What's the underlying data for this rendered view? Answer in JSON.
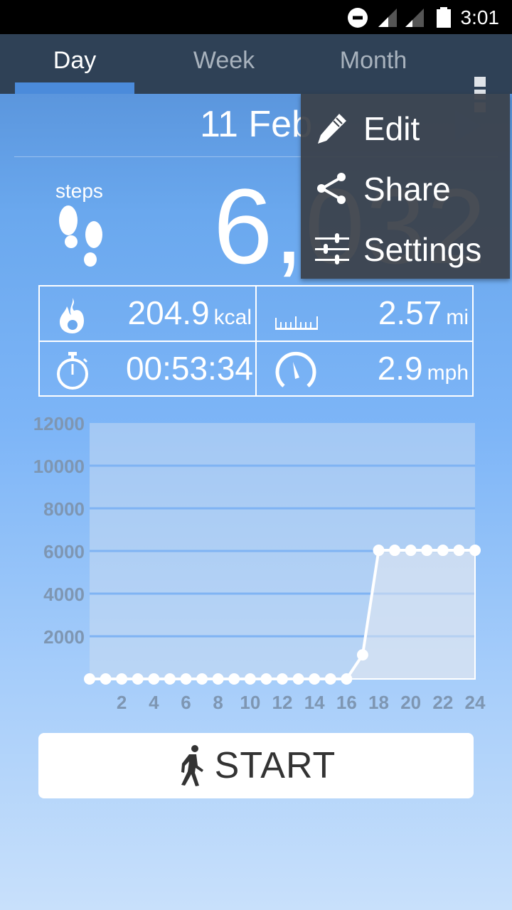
{
  "status_bar": {
    "time": "3:01",
    "icons": [
      "do-not-disturb-icon",
      "signal-icon",
      "signal-icon",
      "battery-icon"
    ]
  },
  "tabs": [
    {
      "label": "Day",
      "active": true
    },
    {
      "label": "Week",
      "active": false
    },
    {
      "label": "Month",
      "active": false
    }
  ],
  "overflow_menu_icon": "more-vert-icon",
  "date": "11 Feb",
  "steps": {
    "label": "steps",
    "value": "6,032",
    "icon": "footprints-icon"
  },
  "stats": {
    "calories": {
      "value": "204.9",
      "unit": "kcal",
      "icon": "flame-icon"
    },
    "distance": {
      "value": "2.57",
      "unit": "mi",
      "icon": "ruler-icon"
    },
    "duration": {
      "value": "00:53:34",
      "icon": "stopwatch-icon"
    },
    "speed": {
      "value": "2.9",
      "unit": "mph",
      "icon": "speedometer-icon"
    }
  },
  "menu": {
    "items": [
      {
        "label": "Edit",
        "icon": "pencil-icon"
      },
      {
        "label": "Share",
        "icon": "share-icon"
      },
      {
        "label": "Settings",
        "icon": "sliders-icon"
      }
    ]
  },
  "start_button": {
    "label": "START",
    "icon": "walking-person-icon"
  },
  "colors": {
    "tab_bar": "#2f4156",
    "tab_indicator": "#4b8bdb",
    "menu_bg": "#3a4048",
    "axis_text": "#7e96b2"
  },
  "chart_data": {
    "type": "line",
    "title": "",
    "xlabel": "",
    "ylabel": "",
    "x": [
      0,
      1,
      2,
      3,
      4,
      5,
      6,
      7,
      8,
      9,
      10,
      11,
      12,
      13,
      14,
      15,
      16,
      17,
      18,
      19,
      20,
      21,
      22,
      23,
      24
    ],
    "series": [
      {
        "name": "steps",
        "values": [
          0,
          0,
          0,
          0,
          0,
          0,
          0,
          0,
          0,
          0,
          0,
          0,
          0,
          0,
          0,
          0,
          0,
          1130,
          6032,
          6032,
          6032,
          6032,
          6032,
          6032,
          6032
        ]
      }
    ],
    "xticks": [
      "2",
      "4",
      "6",
      "8",
      "10",
      "12",
      "14",
      "16",
      "18",
      "20",
      "22",
      "24"
    ],
    "yticks": [
      "2000",
      "4000",
      "6000",
      "8000",
      "10000",
      "12000"
    ],
    "xlim": [
      0,
      24
    ],
    "ylim": [
      0,
      12000
    ],
    "grid": true,
    "legend": "none"
  }
}
